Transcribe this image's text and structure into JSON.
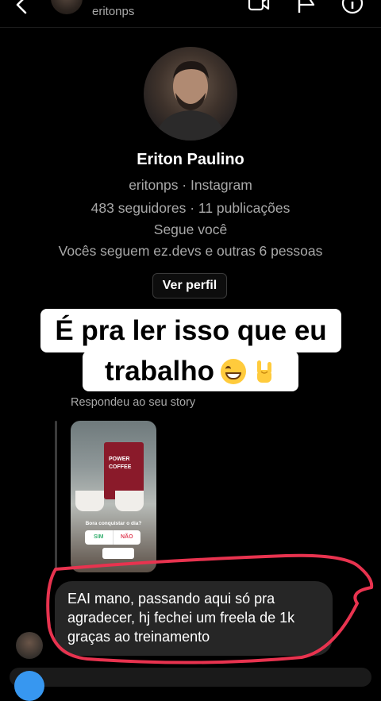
{
  "header": {
    "username": "eritonps",
    "icons": [
      "back-icon",
      "video-call-icon",
      "flag-icon",
      "info-icon"
    ]
  },
  "profile": {
    "name": "Eriton Paulino",
    "handle_line": "eritonps · Instagram",
    "stats_line": "483 seguidores · 11 publicações",
    "follows_you": "Segue você",
    "mutuals_line": "Vocês seguem ez.devs e outras 6 pessoas",
    "view_profile_label": "Ver perfil"
  },
  "caption": {
    "line1": "É pra ler isso que eu",
    "line2": "trabalho",
    "emojis": [
      "grinning-face",
      "sign-of-the-horns"
    ]
  },
  "story_reply": {
    "label": "Respondeu ao seu story",
    "story": {
      "brand": "POWER",
      "product": "COFFEE",
      "poll_question": "Bora conquistar o dia?",
      "poll_yes": "SIM",
      "poll_no": "NÃO"
    }
  },
  "message": {
    "text": "EAI mano, passando aqui só pra agradecer, hj fechei um freela de 1k graças ao treinamento"
  },
  "colors": {
    "background": "#000000",
    "bubble": "#262626",
    "muted_text": "#a8a8a8",
    "highlight_stroke": "#e8334f",
    "accent_blue": "#3797f0"
  }
}
